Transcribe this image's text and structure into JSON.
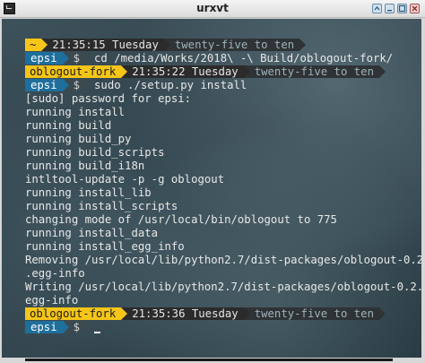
{
  "window": {
    "title": "urxvt"
  },
  "prompt": {
    "home_symbol": "~",
    "dollar": "$"
  },
  "lines": {
    "p1": {
      "dir": "~",
      "time": "21:35:15 Tuesday",
      "words": "twenty-five to ten"
    },
    "c1": {
      "user": "epsi",
      "cmd": "cd /media/Works/2018\\ -\\ Build/oblogout-fork/"
    },
    "p2": {
      "dir": "oblogout-fork",
      "time": "21:35:22 Tuesday",
      "words": "twenty-five to ten"
    },
    "c2": {
      "user": "epsi",
      "cmd": "sudo ./setup.py install"
    },
    "p3": {
      "dir": "oblogout-fork",
      "time": "21:35:36 Tuesday",
      "words": "twenty-five to ten"
    },
    "c3": {
      "user": "epsi",
      "cmd": ""
    }
  },
  "output": [
    "[sudo] password for epsi:",
    "running install",
    "running build",
    "running build_py",
    "running build_scripts",
    "running build_i18n",
    "intltool-update -p -g oblogout",
    "running install_lib",
    "running install_scripts",
    "changing mode of /usr/local/bin/oblogout to 775",
    "running install_data",
    "running install_egg_info",
    "Removing /usr/local/lib/python2.7/dist-packages/oblogout-0.2",
    ".egg-info",
    "Writing /usr/local/lib/python2.7/dist-packages/oblogout-0.2.",
    "egg-info"
  ],
  "colors": {
    "prompt_yellow": "#f5c518",
    "prompt_blue": "#1e6f9c",
    "prompt_dark": "#2b2b2b",
    "background": "#33464f"
  }
}
